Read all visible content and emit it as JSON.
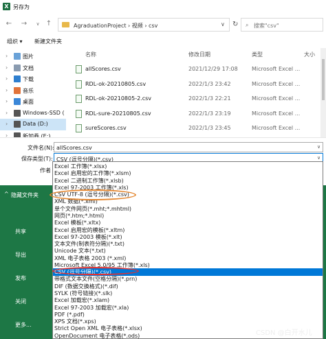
{
  "window": {
    "title": "另存为",
    "app_icon": "X"
  },
  "address": {
    "path": "AgraduationProject  ›  视频  ›  csv",
    "search_placeholder": "搜索\"csv\""
  },
  "toolbar": {
    "organize": "组织 ▾",
    "new_folder": "新建文件夹"
  },
  "nav": [
    {
      "label": "图片",
      "icon": "pictures-icon",
      "color": "#6aa2d8"
    },
    {
      "label": "文档",
      "icon": "documents-icon",
      "color": "#8a9bb0"
    },
    {
      "label": "下载",
      "icon": "downloads-icon",
      "color": "#2f7fcf"
    },
    {
      "label": "音乐",
      "icon": "music-icon",
      "color": "#e2743a"
    },
    {
      "label": "桌面",
      "icon": "desktop-icon",
      "color": "#3a87d8"
    },
    {
      "label": "Windows-SSD (",
      "icon": "drive-icon",
      "color": "#555555"
    },
    {
      "label": "Data (D:)",
      "icon": "drive-icon",
      "color": "#555555"
    },
    {
      "label": "新加卷 (E:)",
      "icon": "drive-icon",
      "color": "#555555"
    }
  ],
  "columns": {
    "name": "名称",
    "date": "修改日期",
    "type": "类型",
    "size": "大小"
  },
  "files": [
    {
      "name": "allScores.csv",
      "date": "2021/12/29 17:08",
      "type": "Microsoft Excel ..."
    },
    {
      "name": "RDL-ok-20210805.csv",
      "date": "2022/1/3 23:42",
      "type": "Microsoft Excel ..."
    },
    {
      "name": "RDL-ok-20210805-2.csv",
      "date": "2022/1/3 22:21",
      "type": "Microsoft Excel ..."
    },
    {
      "name": "RDL-sure-20210805.csv",
      "date": "2022/1/3 23:19",
      "type": "Microsoft Excel ..."
    },
    {
      "name": "sureScores.csv",
      "date": "2022/1/3 23:45",
      "type": "Microsoft Excel ..."
    }
  ],
  "form": {
    "filename_label": "文件名(N):",
    "filename_value": "allScores.csv",
    "filetype_label": "保存类型(T):",
    "filetype_value": "CSV (逗号分隔)(*.csv)",
    "author_label": "作者"
  },
  "backstage": {
    "hide_folders": "隐藏文件夹",
    "items": [
      "共享",
      "导出",
      "发布",
      "关闭",
      "更多..."
    ]
  },
  "filetypes": [
    "Excel 工作簿(*.xlsx)",
    "Excel 启用宏的工作簿(*.xlsm)",
    "Excel 二进制工作簿(*.xlsb)",
    "Excel 97-2003 工作簿(*.xls)",
    "CSV UTF-8 (逗号分隔)(*.csv)",
    "XML 数据(*.xml)",
    "单个文件网页(*.mht;*.mhtml)",
    "网页(*.htm;*.html)",
    "Excel 模板(*.xltx)",
    "Excel 启用宏的模板(*.xltm)",
    "Excel 97-2003 模板(*.xlt)",
    "文本文件(制表符分隔)(*.txt)",
    "Unicode 文本(*.txt)",
    "XML 电子表格 2003 (*.xml)",
    "Microsoft Excel 5.0/95 工作簿(*.xls)",
    "CSV (逗号分隔)(*.csv)",
    "带格式文本文件(空格分隔)(*.prn)",
    "DIF (数据交换格式)(*.dif)",
    "SYLK (符号链接)(*.slk)",
    "Excel 加载宏(*.xlam)",
    "Excel 97-2003 加载宏(*.xla)",
    "PDF (*.pdf)",
    "XPS 文档(*.xps)",
    "Strict Open XML 电子表格(*.xlsx)",
    "OpenDocument 电子表格(*.ods)"
  ],
  "selected_filetype_index": 15,
  "watermark": "CSDN @白开水儿",
  "colors": {
    "excel_green": "#1d7745",
    "selection_blue": "#0078d7",
    "orange_oval": "#e3862f",
    "red_oval": "#e3302f"
  }
}
